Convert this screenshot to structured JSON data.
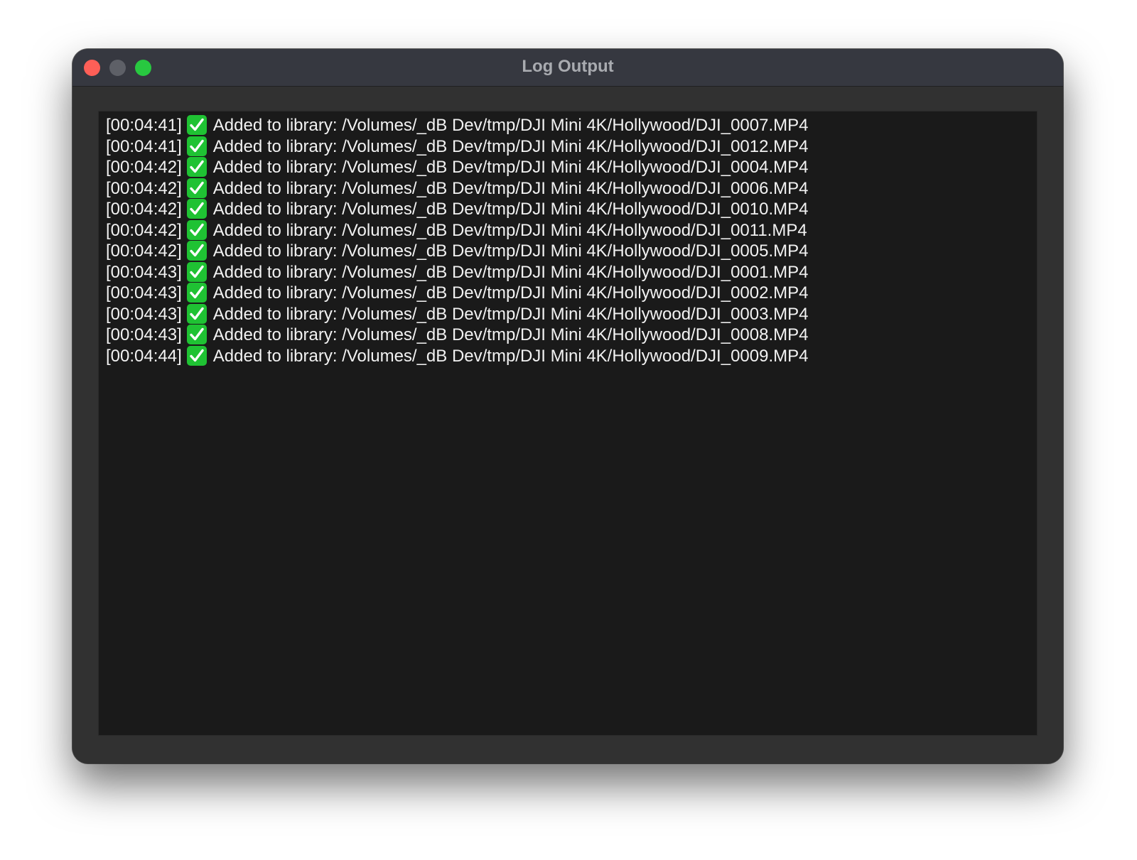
{
  "window": {
    "title": "Log Output"
  },
  "colors": {
    "close": "#fe5f57",
    "minimize": "#5e6067",
    "maximize": "#28c840",
    "check": "#1fc233"
  },
  "log": {
    "status_icon": "check-mark-button-icon",
    "entries": [
      {
        "timestamp": "[00:04:41]",
        "message": "Added to library: /Volumes/_dB Dev/tmp/DJI Mini 4K/Hollywood/DJI_0007.MP4"
      },
      {
        "timestamp": "[00:04:41]",
        "message": "Added to library: /Volumes/_dB Dev/tmp/DJI Mini 4K/Hollywood/DJI_0012.MP4"
      },
      {
        "timestamp": "[00:04:42]",
        "message": "Added to library: /Volumes/_dB Dev/tmp/DJI Mini 4K/Hollywood/DJI_0004.MP4"
      },
      {
        "timestamp": "[00:04:42]",
        "message": "Added to library: /Volumes/_dB Dev/tmp/DJI Mini 4K/Hollywood/DJI_0006.MP4"
      },
      {
        "timestamp": "[00:04:42]",
        "message": "Added to library: /Volumes/_dB Dev/tmp/DJI Mini 4K/Hollywood/DJI_0010.MP4"
      },
      {
        "timestamp": "[00:04:42]",
        "message": "Added to library: /Volumes/_dB Dev/tmp/DJI Mini 4K/Hollywood/DJI_0011.MP4"
      },
      {
        "timestamp": "[00:04:42]",
        "message": "Added to library: /Volumes/_dB Dev/tmp/DJI Mini 4K/Hollywood/DJI_0005.MP4"
      },
      {
        "timestamp": "[00:04:43]",
        "message": "Added to library: /Volumes/_dB Dev/tmp/DJI Mini 4K/Hollywood/DJI_0001.MP4"
      },
      {
        "timestamp": "[00:04:43]",
        "message": "Added to library: /Volumes/_dB Dev/tmp/DJI Mini 4K/Hollywood/DJI_0002.MP4"
      },
      {
        "timestamp": "[00:04:43]",
        "message": "Added to library: /Volumes/_dB Dev/tmp/DJI Mini 4K/Hollywood/DJI_0003.MP4"
      },
      {
        "timestamp": "[00:04:43]",
        "message": "Added to library: /Volumes/_dB Dev/tmp/DJI Mini 4K/Hollywood/DJI_0008.MP4"
      },
      {
        "timestamp": "[00:04:44]",
        "message": "Added to library: /Volumes/_dB Dev/tmp/DJI Mini 4K/Hollywood/DJI_0009.MP4"
      }
    ]
  }
}
